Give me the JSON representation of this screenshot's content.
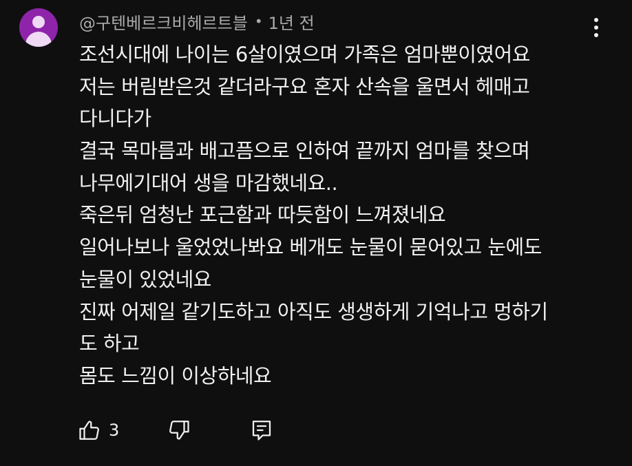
{
  "comment": {
    "author": "@구텐베르크비헤르트블",
    "separator": "•",
    "time_ago": "1년 전",
    "avatar_color": "#8e24aa",
    "avatar_icon": "person-icon",
    "lines": [
      "조선시대에 나이는 6살이였으며 가족은 엄마뿐이였어요",
      "저는 버림받은것 같더라구요 혼자 산속을 울면서 헤매고",
      "다니다가",
      "결국 목마름과 배고픔으로 인하여 끝까지 엄마를 찾으며",
      "나무에기대어 생을 마감했네요..",
      "죽은뒤 엄청난 포근함과 따듯함이 느껴졌네요",
      "일어나보나 울었었나봐요 베개도 눈물이 묻어있고 눈에도",
      "눈물이 있었네요",
      "진짜 어제일 같기도하고 아직도 생생하게 기억나고 멍하기",
      "도 하고",
      "몸도 느낌이 이상하네요"
    ],
    "like_count": "3",
    "icons": {
      "like": "thumbs-up-icon",
      "dislike": "thumbs-down-icon",
      "reply": "reply-comment-icon",
      "more": "more-vertical-icon"
    }
  }
}
